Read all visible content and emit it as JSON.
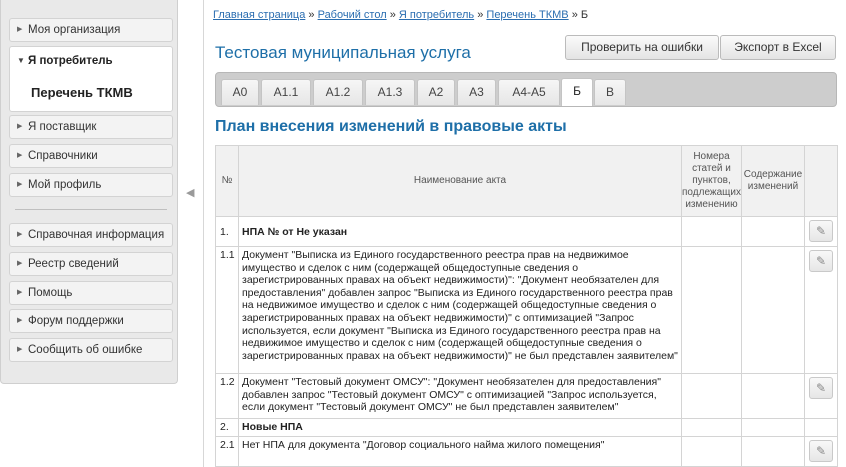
{
  "sidebar": {
    "items_top": [
      "Моя организация"
    ],
    "active": {
      "label": "Я потребитель",
      "sub": "Перечень ТКМВ"
    },
    "items_mid": [
      "Я поставщик",
      "Справочники",
      "Мой профиль"
    ],
    "items_bottom": [
      "Справочная информация",
      "Реестр сведений",
      "Помощь",
      "Форум поддержки",
      "Сообщить об ошибке"
    ]
  },
  "breadcrumb": {
    "items": [
      "Главная страница",
      "Рабочий стол",
      "Я потребитель",
      "Перечень ТКМВ"
    ],
    "separator": "»",
    "current": "Б"
  },
  "page_title": "Тестовая муниципальная услуга",
  "buttons": {
    "check": "Проверить на ошибки",
    "export": "Экспорт в Excel"
  },
  "tabs": [
    "А0",
    "А1.1",
    "А1.2",
    "А1.3",
    "А2",
    "А3",
    "А4-А5",
    "Б",
    "В"
  ],
  "active_tab": "Б",
  "section_title": "План внесения изменений в правовые акты",
  "table": {
    "headers": {
      "num": "№",
      "name": "Наименование акта",
      "articles": "Номера статей и пунктов, подлежащих изменению",
      "content": "Содержание изменений"
    },
    "rows": [
      {
        "num": "1.",
        "bold": true,
        "text": "НПА № от Не указан"
      },
      {
        "num": "1.1",
        "bold": false,
        "text": "Документ \"Выписка из Единого государственного реестра прав на недвижимое имущество и сделок с ним (содержащей общедоступные сведения о зарегистрированных правах на объект недвижимости)\": \"Документ необязателен для предоставления\" добавлен запрос \"Выписка из Единого государственного реестра прав на недвижимое имущество и сделок с ним (содержащей общедоступные сведения о зарегистрированных правах на объект недвижимости)\" с оптимизацией \"Запрос используется, если документ \"Выписка из Единого государственного реестра прав на недвижимое имущество и сделок с ним (содержащей общедоступные сведения о зарегистрированных правах на объект недвижимости)\" не был представлен заявителем\""
      },
      {
        "num": "1.2",
        "bold": false,
        "text": "Документ \"Тестовый документ ОМСУ\": \"Документ необязателен для предоставления\" добавлен запрос \"Тестовый документ ОМСУ\" с оптимизацией \"Запрос используется, если документ \"Тестовый документ ОМСУ\" не был представлен заявителем\""
      },
      {
        "num": "2.",
        "bold": true,
        "text": "Новые НПА"
      },
      {
        "num": "2.1",
        "bold": false,
        "text": "Нет НПА для документа \"Договор социального найма жилого помещения\""
      }
    ]
  }
}
